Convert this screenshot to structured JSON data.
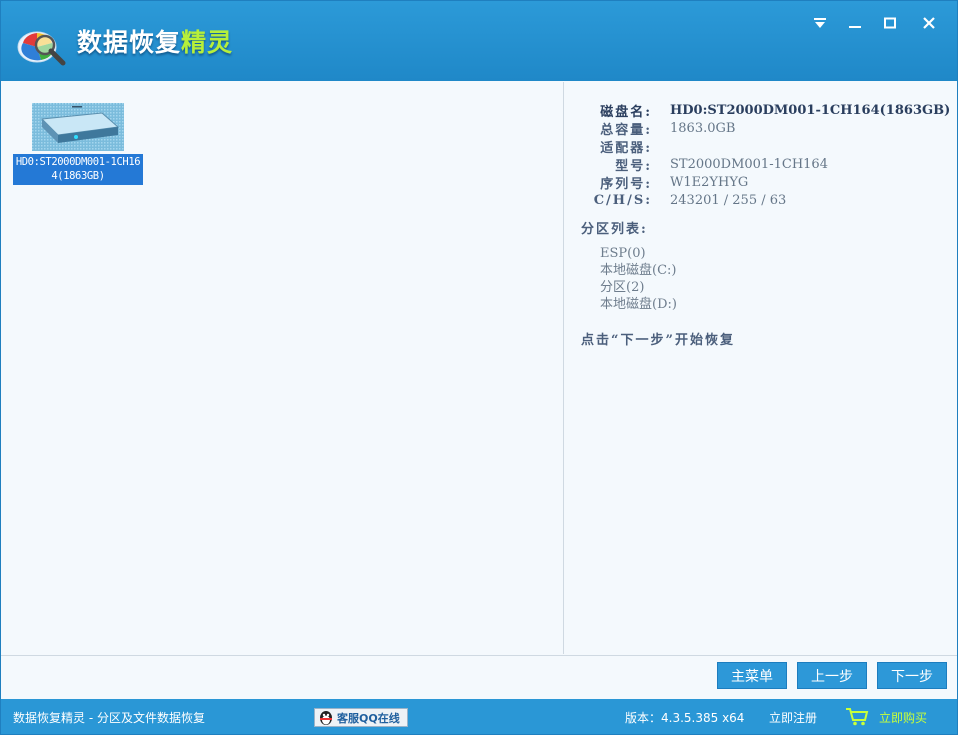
{
  "app": {
    "title_main": "数据恢复",
    "title_accent": "精灵"
  },
  "window_controls": {
    "menu": "menu-dropdown-icon",
    "minimize": "minimize-icon",
    "maximize": "maximize-icon",
    "close": "close-icon"
  },
  "disk": {
    "caption": "HD0:ST2000DM001-1CH164(1863GB)"
  },
  "info": {
    "rows": [
      {
        "key": "磁盘名:",
        "value": "HD0:ST2000DM001-1CH164(1863GB)"
      },
      {
        "key": "总容量:",
        "value": "1863.0GB"
      },
      {
        "key": "适配器:",
        "value": ""
      },
      {
        "key": "型号:",
        "value": "ST2000DM001-1CH164"
      },
      {
        "key": "序列号:",
        "value": "W1E2YHYG"
      },
      {
        "key": "C/H/S:",
        "value": "243201 / 255 / 63"
      }
    ],
    "partition_title": "分区列表:",
    "partitions": [
      "ESP(0)",
      "本地磁盘(C:)",
      "分区(2)",
      "本地磁盘(D:)"
    ],
    "hint": "点击“下一步”开始恢复"
  },
  "buttons": {
    "main_menu": "主菜单",
    "prev": "上一步",
    "next": "下一步"
  },
  "status": {
    "left_text": "数据恢复精灵 - 分区及文件数据恢复",
    "qq": "客服QQ在线",
    "version": "版本：4.3.5.385 x64",
    "register": "立即注册",
    "buy": "立即购买"
  },
  "colors": {
    "titlebar": "#2c9ad8",
    "button": "#2d98d8",
    "selection": "#2479d6",
    "buy_accent": "#c8ff3a"
  }
}
